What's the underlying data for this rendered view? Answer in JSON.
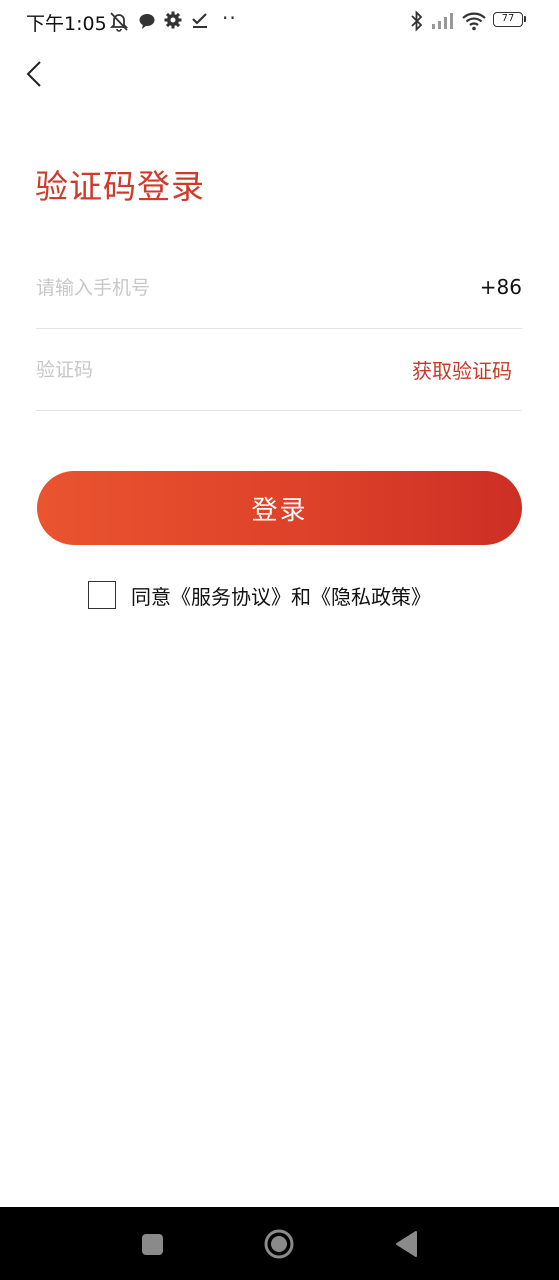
{
  "status_bar": {
    "time": "下午1:05",
    "dots": "··",
    "battery": "77",
    "icons": [
      "mute-bell-icon",
      "chat-bubble-icon",
      "gear-icon",
      "check-icon",
      "bluetooth-icon",
      "signal-icon",
      "wifi-icon",
      "battery-icon"
    ]
  },
  "header": {
    "back_icon": "chevron-left-icon",
    "title": "验证码登录"
  },
  "form": {
    "phone_placeholder": "请输入手机号",
    "country_code": "+86",
    "code_placeholder": "验证码",
    "get_code_label": "获取验证码",
    "login_label": "登录"
  },
  "agreement": {
    "prefix": "同意",
    "service_link": "《服务协议》",
    "connector": "和",
    "privacy_link": "《隐私政策》",
    "checked": false
  },
  "nav_bar": {
    "buttons": [
      "recent-apps-icon",
      "home-icon",
      "back-triangle-icon"
    ]
  },
  "colors": {
    "accent": "#cf3b2b",
    "button_gradient_start": "#ea542f",
    "button_gradient_end": "#cc2f24",
    "placeholder": "#c8c8c8",
    "divider": "#e3e3e3",
    "nav_bar": "#000000"
  }
}
